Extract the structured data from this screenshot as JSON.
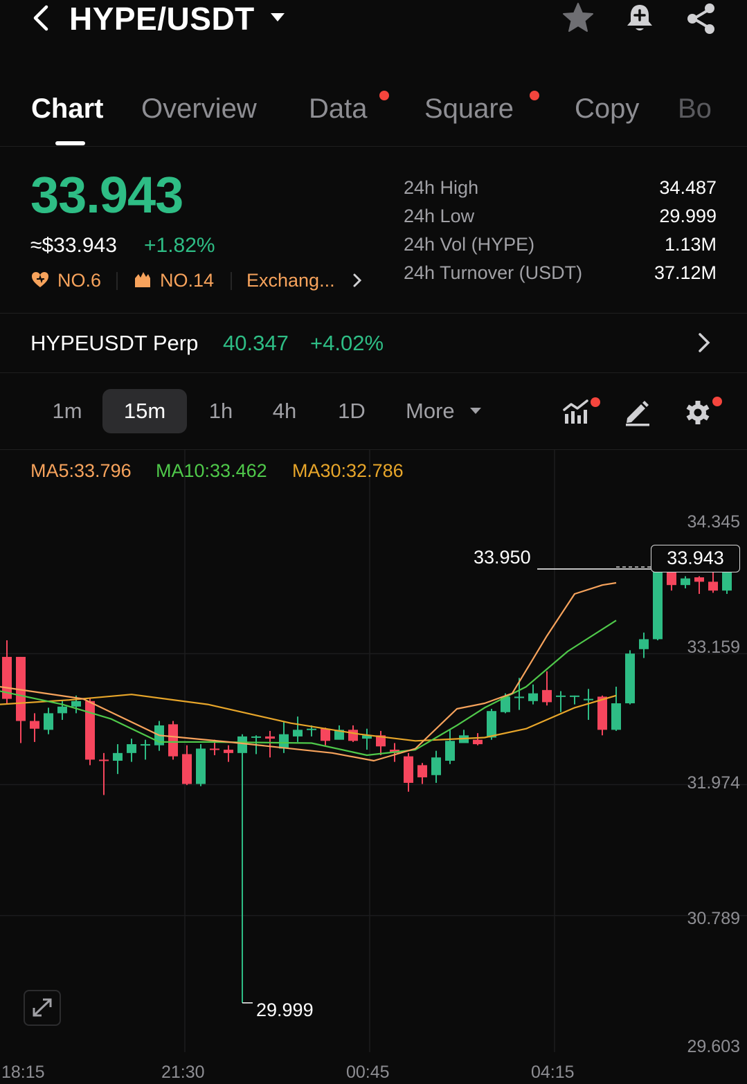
{
  "header": {
    "pair": "HYPE/USDT",
    "icons": [
      "back-icon",
      "caret-down-icon",
      "star-icon",
      "bell-add-icon",
      "share-icon"
    ]
  },
  "tabs": [
    {
      "label": "Chart",
      "active": true,
      "dot": false
    },
    {
      "label": "Overview",
      "active": false,
      "dot": false
    },
    {
      "label": "Data",
      "active": false,
      "dot": true
    },
    {
      "label": "Square",
      "active": false,
      "dot": true
    },
    {
      "label": "Copy",
      "active": false,
      "dot": false
    },
    {
      "label": "Bo",
      "active": false,
      "dot": false
    }
  ],
  "ticker": {
    "last_price": "33.943",
    "usd_price": "≈$33.943",
    "change_pct": "+1.82%",
    "rank_1": "NO.6",
    "rank_2": "NO.14",
    "exchange_link": "Exchang...",
    "stats": [
      {
        "label": "24h High",
        "value": "34.487"
      },
      {
        "label": "24h Low",
        "value": "29.999"
      },
      {
        "label": "24h Vol (HYPE)",
        "value": "1.13M"
      },
      {
        "label": "24h Turnover (USDT)",
        "value": "37.12M"
      }
    ]
  },
  "perp": {
    "name": "HYPEUSDT Perp",
    "price": "40.347",
    "change": "+4.02%"
  },
  "intervals": [
    {
      "label": "1m",
      "active": false
    },
    {
      "label": "15m",
      "active": true
    },
    {
      "label": "1h",
      "active": false
    },
    {
      "label": "4h",
      "active": false
    },
    {
      "label": "1D",
      "active": false
    },
    {
      "label": "More",
      "active": false
    }
  ],
  "ma": {
    "ma5": "MA5:33.796",
    "ma10": "MA10:33.462",
    "ma30": "MA30:32.786"
  },
  "colors": {
    "up": "#2ebd85",
    "down": "#f6465d",
    "ma5": "#f7a35c",
    "ma10": "#4fc94a",
    "ma30": "#e8a62a",
    "rank": "#f7a35c"
  },
  "chart_data": {
    "type": "candlestick",
    "interval": "15m",
    "y_axis_ticks": [
      "34.345",
      "33.159",
      "31.974",
      "30.789",
      "29.603"
    ],
    "x_axis_ticks": [
      "18:15",
      "21:30",
      "00:45",
      "04:15"
    ],
    "ylim": [
      29.603,
      34.345
    ],
    "current_price": "33.943",
    "high_marker": "33.950",
    "low_marker": "29.999",
    "candles": [
      [
        33.13,
        32.75,
        33.28,
        32.7
      ],
      [
        33.13,
        32.55,
        33.13,
        32.35
      ],
      [
        32.55,
        32.48,
        32.62,
        32.36
      ],
      [
        32.47,
        32.62,
        32.67,
        32.43
      ],
      [
        32.62,
        32.68,
        32.74,
        32.56
      ],
      [
        32.68,
        32.73,
        32.78,
        32.62
      ],
      [
        32.73,
        32.2,
        32.76,
        32.15
      ],
      [
        32.2,
        32.19,
        32.26,
        31.88
      ],
      [
        32.19,
        32.26,
        32.34,
        32.07
      ],
      [
        32.26,
        32.34,
        32.39,
        32.18
      ],
      [
        32.34,
        32.34,
        32.38,
        32.2
      ],
      [
        32.33,
        32.51,
        32.55,
        32.28
      ],
      [
        32.52,
        32.23,
        32.55,
        32.2
      ],
      [
        32.25,
        31.98,
        32.33,
        31.97
      ],
      [
        31.98,
        32.3,
        32.34,
        31.96
      ],
      [
        32.3,
        32.29,
        32.38,
        32.24
      ],
      [
        32.29,
        32.26,
        32.33,
        32.18
      ],
      [
        32.26,
        32.41,
        32.43,
        29.999
      ],
      [
        32.41,
        32.41,
        32.42,
        32.25
      ],
      [
        32.41,
        32.39,
        32.46,
        32.22
      ],
      [
        32.3,
        32.43,
        32.54,
        32.26
      ],
      [
        32.41,
        32.47,
        32.59,
        32.36
      ],
      [
        32.47,
        32.48,
        32.51,
        32.41
      ],
      [
        32.48,
        32.37,
        32.49,
        32.33
      ],
      [
        32.38,
        32.47,
        32.51,
        32.39
      ],
      [
        32.47,
        32.37,
        32.51,
        32.36
      ],
      [
        32.39,
        32.42,
        32.48,
        32.29
      ],
      [
        32.42,
        32.32,
        32.46,
        32.24
      ],
      [
        32.29,
        32.26,
        32.35,
        32.18
      ],
      [
        32.23,
        31.99,
        32.26,
        31.91
      ],
      [
        32.15,
        32.04,
        32.17,
        31.98
      ],
      [
        32.06,
        32.22,
        32.28,
        31.99
      ],
      [
        32.19,
        32.37,
        32.47,
        32.16
      ],
      [
        32.35,
        32.42,
        32.47,
        32.38
      ],
      [
        32.38,
        32.34,
        32.44,
        32.33
      ],
      [
        32.4,
        32.64,
        32.66,
        32.38
      ],
      [
        32.63,
        32.77,
        32.8,
        32.62
      ],
      [
        32.77,
        32.77,
        32.94,
        32.65
      ],
      [
        32.73,
        32.8,
        32.88,
        32.7
      ],
      [
        32.83,
        32.72,
        33.0,
        32.69
      ],
      [
        32.78,
        32.78,
        32.82,
        32.63
      ],
      [
        32.77,
        32.78,
        32.78,
        32.7
      ],
      [
        32.75,
        32.75,
        32.84,
        32.56
      ],
      [
        32.77,
        32.47,
        32.78,
        32.42
      ],
      [
        32.47,
        32.71,
        32.86,
        32.46
      ],
      [
        32.71,
        33.16,
        33.19,
        32.7
      ],
      [
        33.2,
        33.29,
        33.35,
        33.12
      ],
      [
        33.29,
        33.94,
        33.95,
        33.28
      ],
      [
        33.92,
        33.78,
        33.94,
        33.73
      ],
      [
        33.78,
        33.84,
        33.86,
        33.75
      ],
      [
        33.85,
        33.81,
        33.86,
        33.7
      ],
      [
        33.81,
        33.73,
        33.9,
        33.71
      ],
      [
        33.73,
        33.94,
        33.96,
        33.7
      ]
    ],
    "ma5_path": [
      [
        0,
        32.86
      ],
      [
        120,
        32.75
      ],
      [
        230,
        32.42
      ],
      [
        330,
        32.36
      ],
      [
        480,
        32.26
      ],
      [
        540,
        32.19
      ],
      [
        600,
        32.3
      ],
      [
        660,
        32.66
      ],
      [
        700,
        32.71
      ],
      [
        740,
        32.8
      ],
      [
        790,
        33.32
      ],
      [
        830,
        33.7
      ],
      [
        870,
        33.78
      ],
      [
        890,
        33.8
      ]
    ],
    "ma10_path": [
      [
        0,
        32.82
      ],
      [
        90,
        32.7
      ],
      [
        160,
        32.57
      ],
      [
        230,
        32.36
      ],
      [
        300,
        32.36
      ],
      [
        450,
        32.35
      ],
      [
        530,
        32.24
      ],
      [
        600,
        32.29
      ],
      [
        660,
        32.51
      ],
      [
        700,
        32.67
      ],
      [
        760,
        32.86
      ],
      [
        820,
        33.18
      ],
      [
        890,
        33.46
      ]
    ],
    "ma30_path": [
      [
        0,
        32.7
      ],
      [
        100,
        32.74
      ],
      [
        190,
        32.79
      ],
      [
        300,
        32.7
      ],
      [
        420,
        32.53
      ],
      [
        520,
        32.43
      ],
      [
        600,
        32.37
      ],
      [
        700,
        32.4
      ],
      [
        760,
        32.48
      ],
      [
        830,
        32.67
      ],
      [
        890,
        32.78
      ]
    ]
  }
}
